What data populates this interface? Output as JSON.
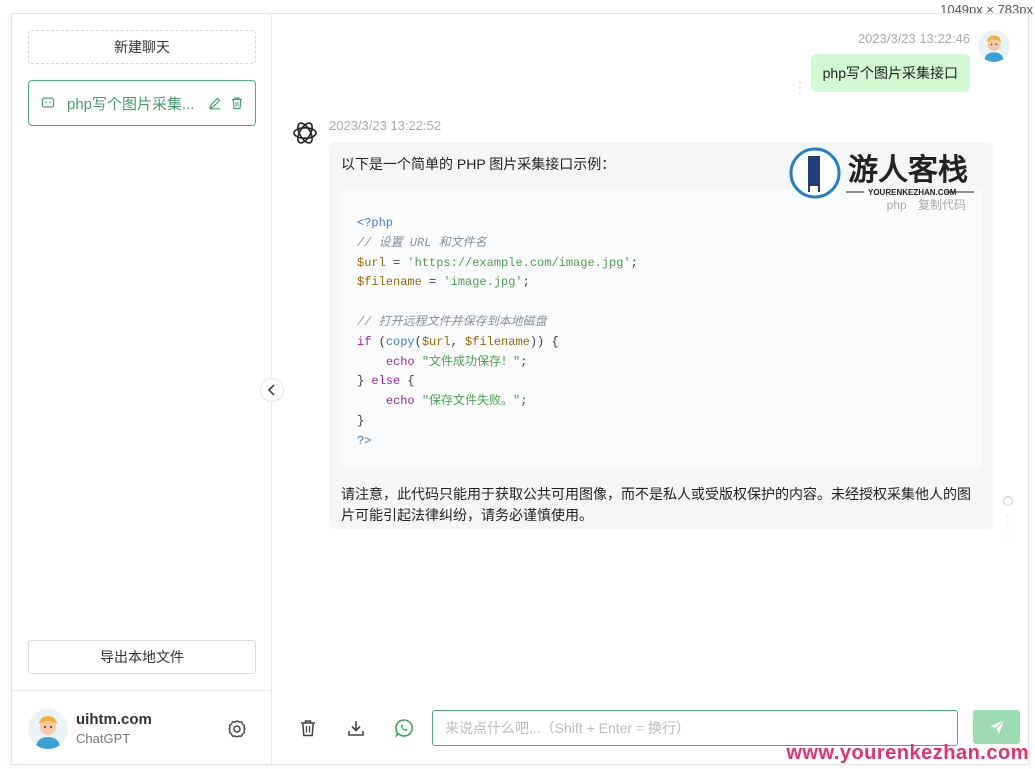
{
  "screenshot_size_label": "1049px × 783px",
  "sidebar": {
    "new_chat_label": "新建聊天",
    "chats": [
      {
        "title": "php写个图片采集..."
      }
    ],
    "export_label": "导出本地文件",
    "user": {
      "name": "uihtm.com",
      "subtitle": "ChatGPT"
    }
  },
  "conversation": {
    "user_message": {
      "time": "2023/3/23 13:22:46",
      "text": "php写个图片采集接口"
    },
    "bot_message": {
      "time": "2023/3/23 13:22:52",
      "intro": "以下是一个简单的 PHP 图片采集接口示例：",
      "code_language": "php",
      "copy_label": "复制代码",
      "code_lines": [
        "<?php",
        "// 设置 URL 和文件名",
        "$url = 'https://example.com/image.jpg';",
        "$filename = 'image.jpg';",
        "",
        "// 打开远程文件并保存到本地磁盘",
        "if (copy($url, $filename)) {",
        "    echo \"文件成功保存！\";",
        "} else {",
        "    echo \"保存文件失败。\";",
        "}",
        "?>"
      ],
      "note": "请注意，此代码只能用于获取公共可用图像，而不是私人或受版权保护的内容。未经授权采集他人的图片可能引起法律纠纷，请务必谨慎使用。"
    }
  },
  "watermark": {
    "name": "游人客栈",
    "domain": "YOURENKEZHAN.COM"
  },
  "input": {
    "placeholder": "来说点什么吧...（Shift + Enter = 换行）"
  },
  "site_url": "www.yourenkezhan.com",
  "colors": {
    "accent": "#4caf7a",
    "user_bubble": "#d2f9d1",
    "send_button": "#9ddcb3",
    "url_text": "#e6306a"
  }
}
